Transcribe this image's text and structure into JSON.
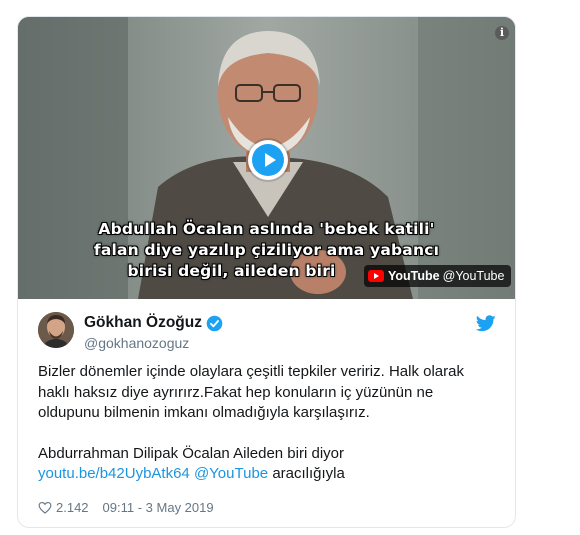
{
  "video": {
    "subtitle_line1": "Abdullah Öcalan aslında 'bebek katili'",
    "subtitle_line2": "falan diye  yazılıp çiziliyor ama yabancı",
    "subtitle_line3": "birisi değil, aileden biri",
    "badge_brand": "YouTube",
    "badge_handle": "@YouTube",
    "info_glyph": "i"
  },
  "author": {
    "name": "Gökhan Özoğuz",
    "handle": "@gokhanozoguz"
  },
  "tweet": {
    "line1": "Bizler dönemler içinde olaylara çeşitli tepkiler veririz. Halk olarak",
    "line2": "haklı haksız diye ayrırırz.Fakat hep konuların iç yüzünün ne",
    "line3": "oldupunu bilmenin imkanı olmadığıyla karşılaşırız.",
    "line4": "Abdurrahman Dilipak Öcalan Aileden biri diyor",
    "link": "youtu.be/b42UybAtk64",
    "mention": "@YouTube",
    "suffix": "aracılığıyla"
  },
  "meta": {
    "likes": "2.142",
    "time": "09:11 - 3 May 2019"
  },
  "colors": {
    "link": "#1b95e0",
    "twitter_blue": "#1da1f2",
    "youtube_red": "#ff0000"
  },
  "icons": [
    "info-icon",
    "play-icon",
    "youtube-logo-icon",
    "verified-badge-icon",
    "twitter-bird-icon",
    "heart-icon"
  ]
}
